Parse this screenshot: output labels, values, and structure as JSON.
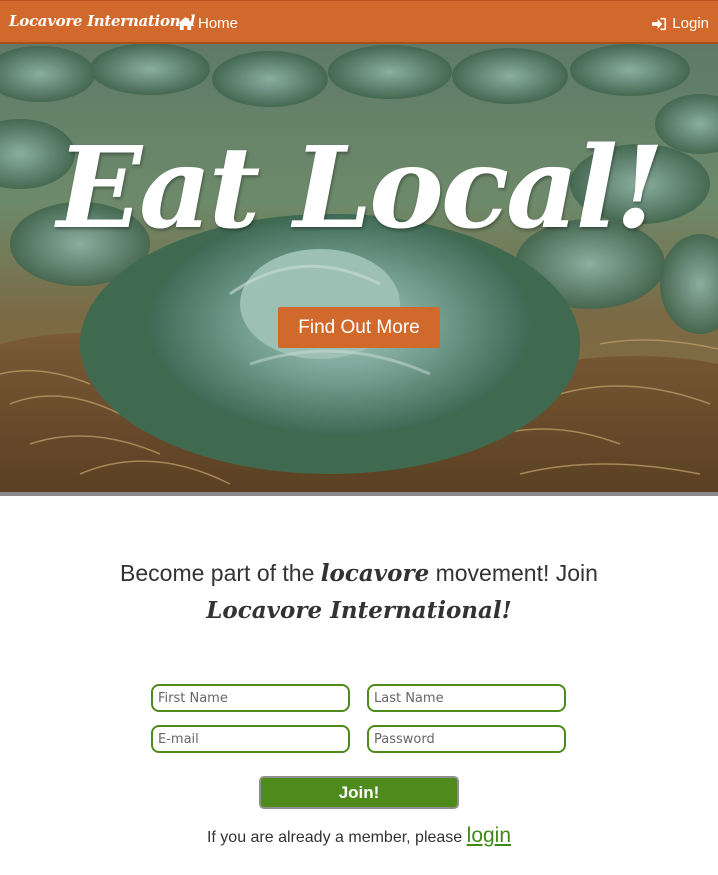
{
  "navbar": {
    "brand": "Locavore International",
    "home_label": "Home",
    "home_icon": "home-icon",
    "login_label": "Login",
    "login_icon": "sign-in-icon",
    "color": "#d2692c"
  },
  "hero": {
    "title": "Eat Local!",
    "cta_label": "Find Out More",
    "cta_color": "#d2692c"
  },
  "join": {
    "heading_part1": "Become part of the ",
    "heading_brand_word": "locavore",
    "heading_part2": " movement! Join ",
    "heading_brand": "Locavore International!",
    "fields": {
      "first_name_placeholder": "First Name",
      "last_name_placeholder": "Last Name",
      "email_placeholder": "E-mail",
      "password_placeholder": "Password"
    },
    "button_label": "Join!",
    "button_color": "#4f8a1c",
    "member_text": "If you are already a member, please ",
    "member_link": "login"
  }
}
